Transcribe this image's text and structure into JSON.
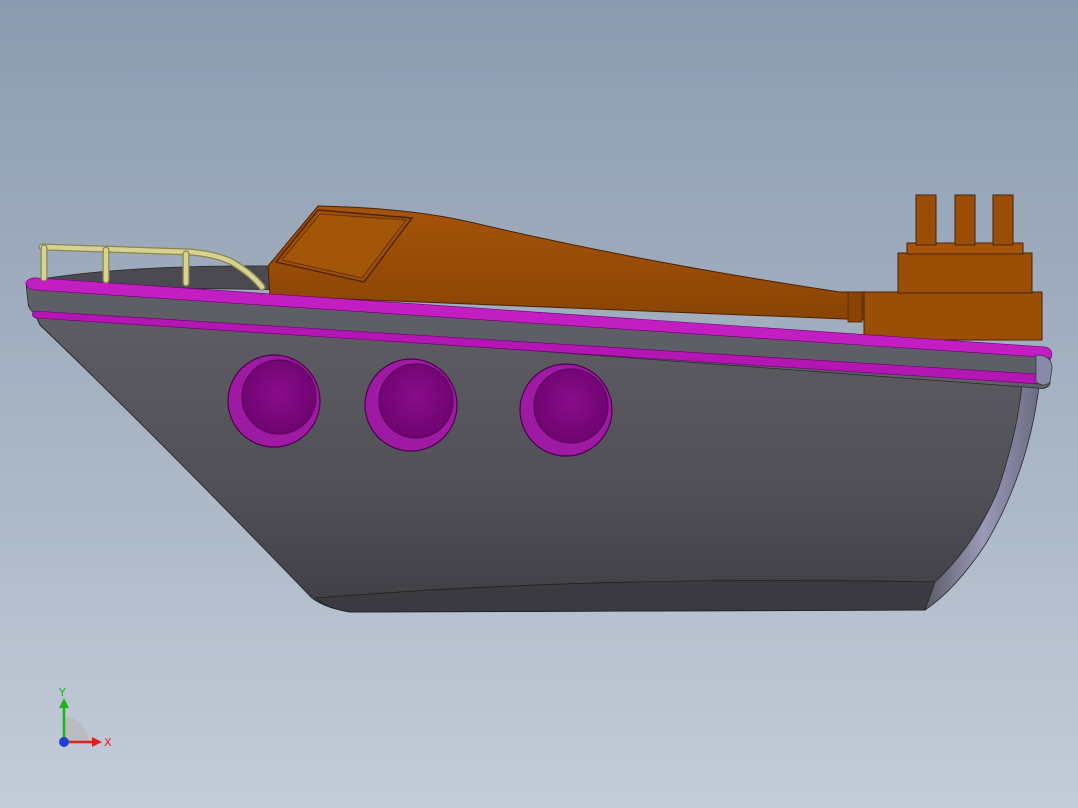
{
  "viewport": {
    "background_top": "#8c9cb0",
    "background_bottom": "#c4ccd8"
  },
  "model": {
    "parts": [
      "hull",
      "deck-trim",
      "portholes",
      "cabin",
      "windshield",
      "railing",
      "funnel-base",
      "funnel-pipes"
    ],
    "colors": {
      "hull": "#4f4f55",
      "trim": "#c21ec2",
      "porthole": "#8a0a8c",
      "cabin": "#9b4d05",
      "railing": "#d6d08a",
      "deck": "#4a4a50"
    },
    "porthole_count": 3,
    "funnel_pipe_count": 3
  },
  "triad": {
    "x_label": "X",
    "y_label": "Y",
    "x_color": "#e02020",
    "y_color": "#20b020",
    "z_color": "#2040d0"
  }
}
